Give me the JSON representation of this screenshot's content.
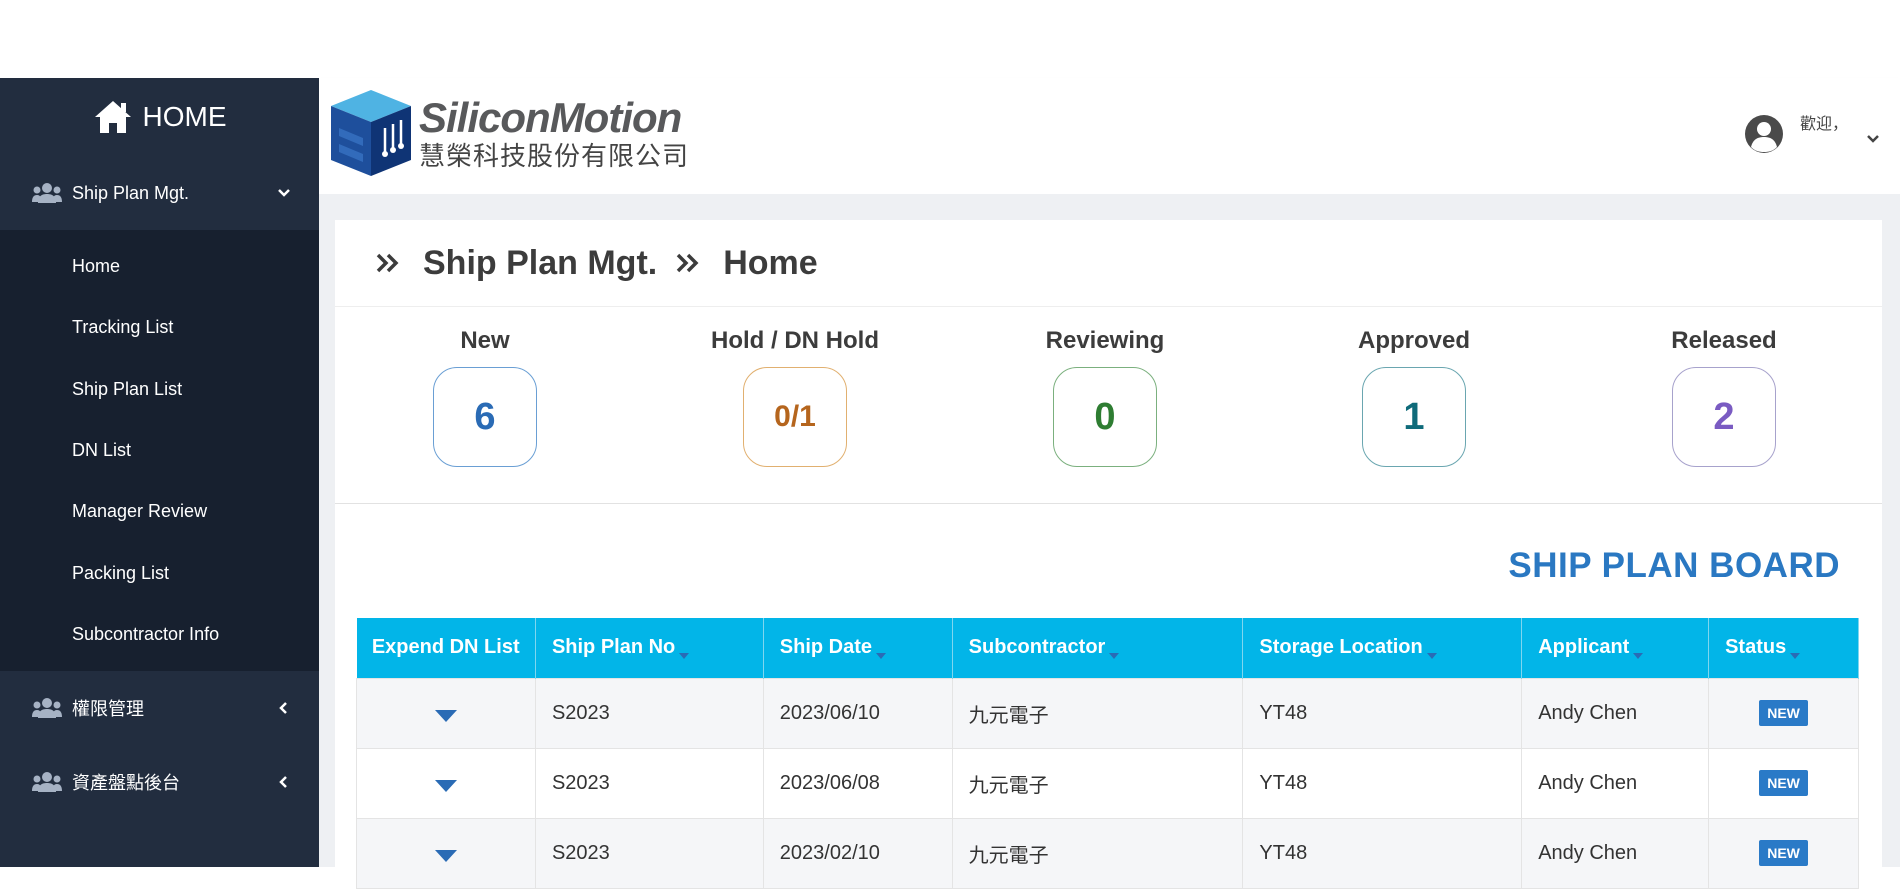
{
  "sidebar": {
    "home_label": "HOME",
    "groups": [
      {
        "label": "Ship Plan Mgt.",
        "icon": "users-icon",
        "expanded": true
      },
      {
        "label": "權限管理",
        "icon": "users-icon",
        "expanded": false
      },
      {
        "label": "資產盤點後台",
        "icon": "users-icon",
        "expanded": false
      }
    ],
    "sub_items": [
      {
        "label": "Home"
      },
      {
        "label": "Tracking List"
      },
      {
        "label": "Ship Plan List"
      },
      {
        "label": "DN List"
      },
      {
        "label": "Manager Review"
      },
      {
        "label": "Packing List"
      },
      {
        "label": "Subcontractor Info"
      }
    ]
  },
  "header": {
    "logo_en": "SiliconMotion",
    "logo_zh": "慧榮科技股份有限公司",
    "welcome": "歡迎，"
  },
  "breadcrumb": {
    "section": "Ship Plan Mgt.",
    "page": "Home"
  },
  "stats": [
    {
      "label": "New",
      "value": "6",
      "color": "#2a6bb5"
    },
    {
      "label": "Hold / DN Hold",
      "value": "0/1",
      "color": "#b5651d"
    },
    {
      "label": "Reviewing",
      "value": "0",
      "color": "#2e7d32"
    },
    {
      "label": "Approved",
      "value": "1",
      "color": "#0f6b7a"
    },
    {
      "label": "Released",
      "value": "2",
      "color": "#7a5bc2"
    }
  ],
  "board": {
    "title": "SHIP PLAN BOARD",
    "columns": [
      "Expend DN List",
      "Ship Plan No",
      "Ship Date",
      "Subcontractor",
      "Storage Location",
      "Applicant",
      "Status"
    ],
    "rows": [
      {
        "ship_plan_no": "S2023",
        "ship_date": "2023/06/10",
        "subcontractor": "九元電子",
        "storage_location": "YT48",
        "applicant": "Andy Chen",
        "status": "NEW"
      },
      {
        "ship_plan_no": "S2023",
        "ship_date": "2023/06/08",
        "subcontractor": "九元電子",
        "storage_location": "YT48",
        "applicant": "Andy Chen",
        "status": "NEW"
      },
      {
        "ship_plan_no": "S2023",
        "ship_date": "2023/02/10",
        "subcontractor": "九元電子",
        "storage_location": "YT48",
        "applicant": "Andy Chen",
        "status": "NEW"
      }
    ]
  },
  "colors": {
    "sidebar_bg": "#222d3f",
    "sidebar_sub_bg": "#17202f",
    "table_header_bg": "#02b5e8",
    "board_title": "#2a78c2",
    "badge_bg": "#2a7ac7"
  }
}
